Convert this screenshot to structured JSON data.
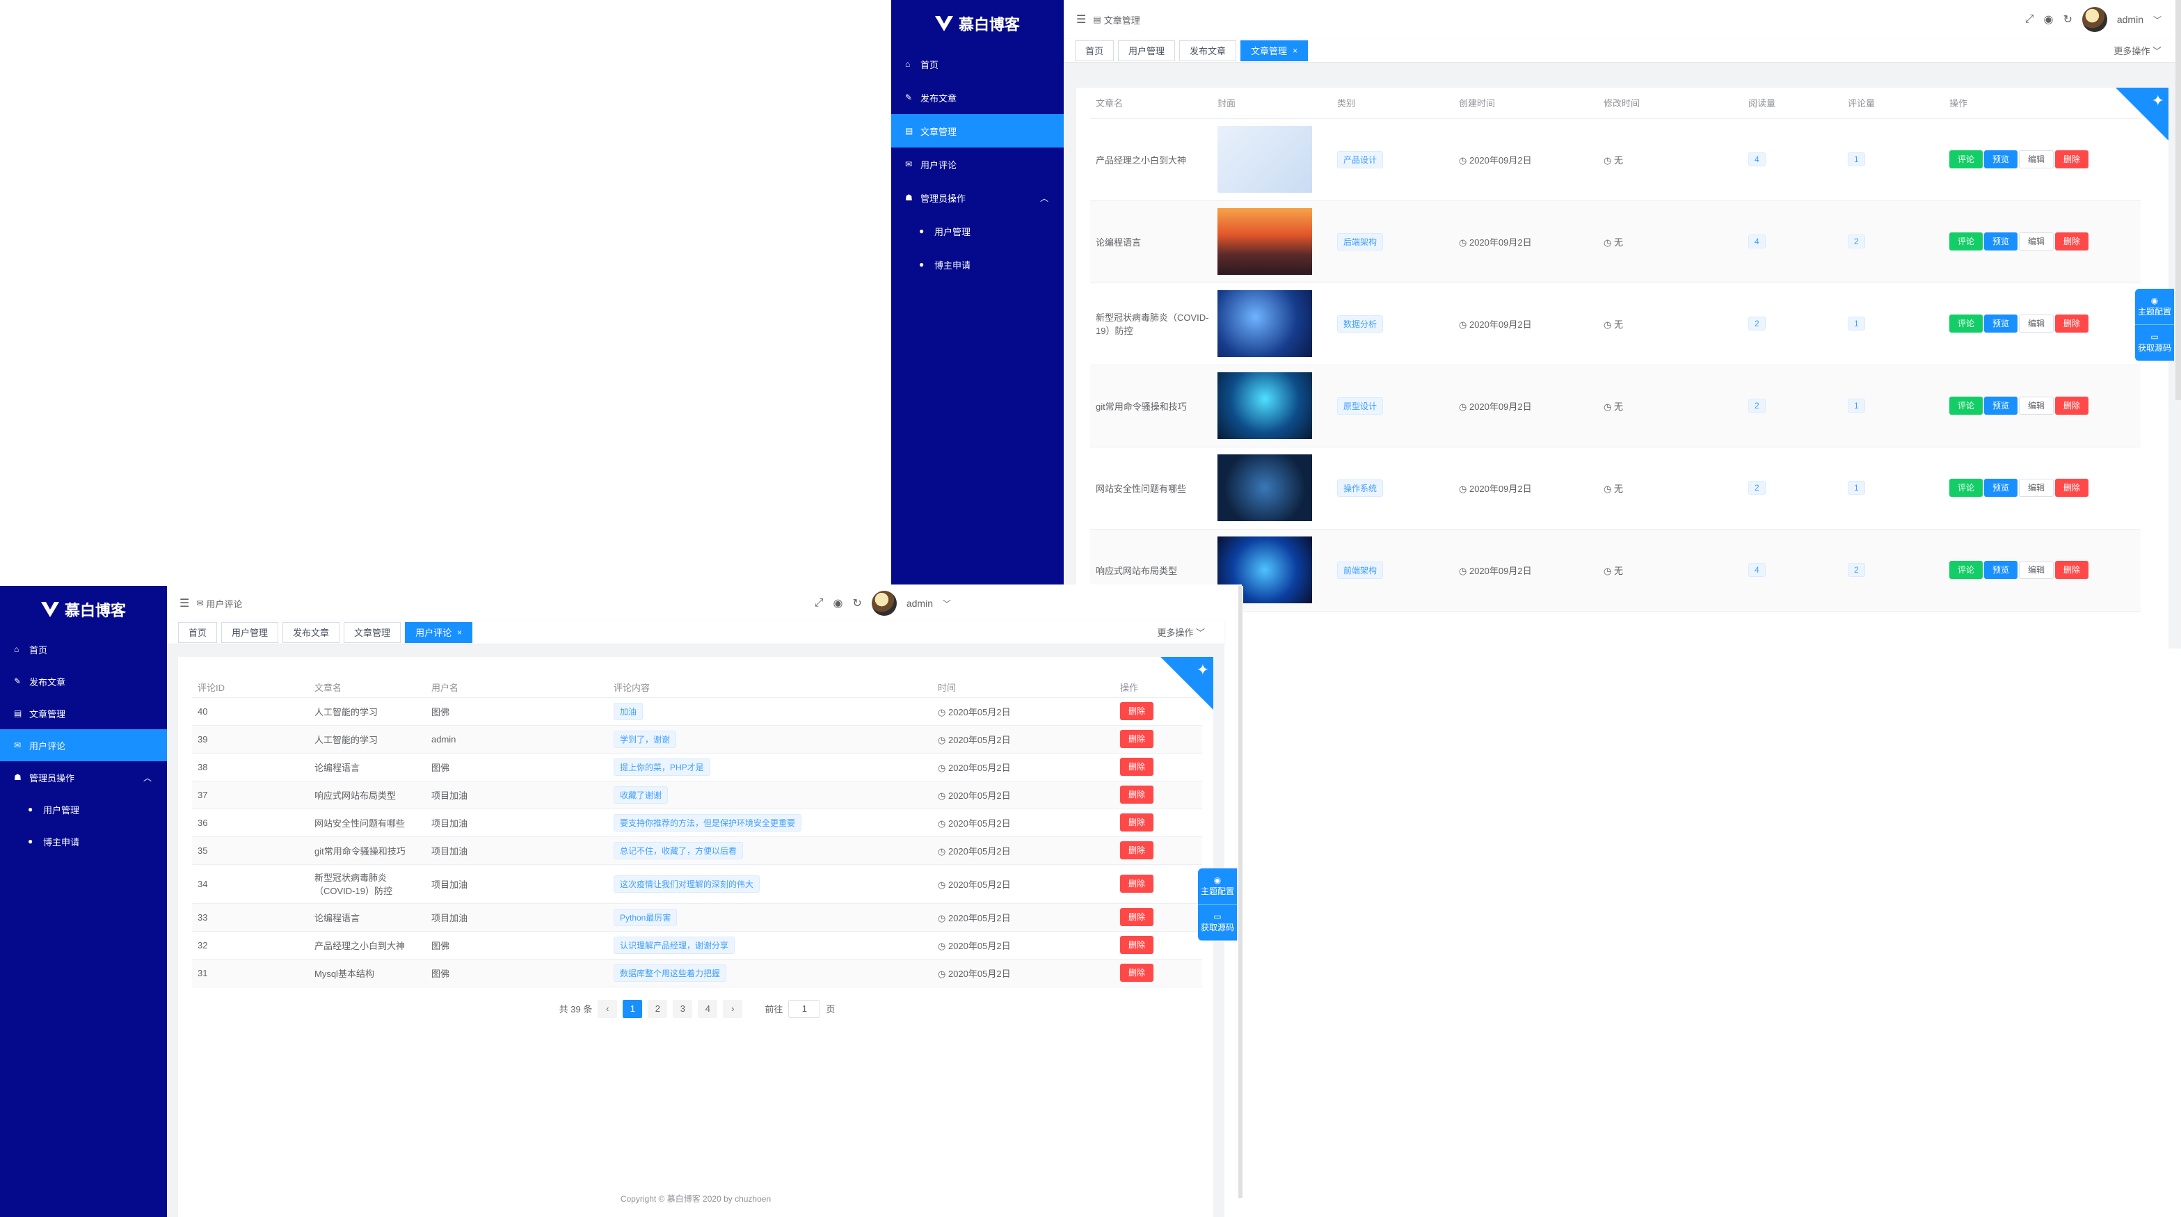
{
  "brand": "慕白博客",
  "sidebar": {
    "items": [
      {
        "label": "首页",
        "icon": "home-icon"
      },
      {
        "label": "发布文章",
        "icon": "edit-icon"
      },
      {
        "label": "文章管理",
        "icon": "book-icon"
      },
      {
        "label": "用户评论",
        "icon": "comment-icon"
      },
      {
        "label": "管理员操作",
        "icon": "users-icon"
      },
      {
        "label": "用户管理",
        "icon": "user-icon"
      },
      {
        "label": "博主申请",
        "icon": "user-icon"
      }
    ]
  },
  "header": {
    "admin": "admin",
    "more_ops": "更多操作"
  },
  "top_window": {
    "breadcrumb": "文章管理",
    "tabs": [
      "首页",
      "用户管理",
      "发布文章",
      "文章管理"
    ],
    "columns": [
      "文章名",
      "封面",
      "类别",
      "创建时间",
      "修改时间",
      "阅读量",
      "评论量",
      "操作"
    ],
    "rows": [
      {
        "title": "产品经理之小白到大神",
        "category": "产品设计",
        "created": "2020年09月2日",
        "modified": "无",
        "reads": "4",
        "comments": "1"
      },
      {
        "title": "论编程语言",
        "category": "后端架构",
        "created": "2020年09月2日",
        "modified": "无",
        "reads": "4",
        "comments": "2"
      },
      {
        "title": "新型冠状病毒肺炎（COVID-19）防控",
        "category": "数据分析",
        "created": "2020年09月2日",
        "modified": "无",
        "reads": "2",
        "comments": "1"
      },
      {
        "title": "git常用命令骚操和技巧",
        "category": "原型设计",
        "created": "2020年09月2日",
        "modified": "无",
        "reads": "2",
        "comments": "1"
      },
      {
        "title": "网站安全性问题有哪些",
        "category": "操作系统",
        "created": "2020年09月2日",
        "modified": "无",
        "reads": "2",
        "comments": "1"
      },
      {
        "title": "响应式网站布局类型",
        "category": "前端架构",
        "created": "2020年09月2日",
        "modified": "无",
        "reads": "4",
        "comments": "2"
      }
    ],
    "actions": {
      "comment": "评论",
      "preview": "预览",
      "edit": "编辑",
      "delete": "删除"
    }
  },
  "side_tools": {
    "theme": "主题配置",
    "source": "获取源码"
  },
  "bottom_window": {
    "breadcrumb": "用户评论",
    "tabs": [
      "首页",
      "用户管理",
      "发布文章",
      "文章管理",
      "用户评论"
    ],
    "columns": [
      "评论ID",
      "文章名",
      "用户名",
      "评论内容",
      "时间",
      "操作"
    ],
    "rows": [
      {
        "id": "40",
        "article": "人工智能的学习",
        "user": "图佛",
        "content": "加油",
        "time": "2020年05月2日"
      },
      {
        "id": "39",
        "article": "人工智能的学习",
        "user": "admin",
        "content": "学到了，谢谢",
        "time": "2020年05月2日"
      },
      {
        "id": "38",
        "article": "论编程语言",
        "user": "图佛",
        "content": "提上你的菜，PHP才是",
        "time": "2020年05月2日"
      },
      {
        "id": "37",
        "article": "响应式网站布局类型",
        "user": "项目加油",
        "content": "收藏了谢谢",
        "time": "2020年05月2日"
      },
      {
        "id": "36",
        "article": "网站安全性问题有哪些",
        "user": "项目加油",
        "content": "要支持你推荐的方法，但是保护环境安全更重要",
        "time": "2020年05月2日"
      },
      {
        "id": "35",
        "article": "git常用命令骚操和技巧",
        "user": "项目加油",
        "content": "总记不住，收藏了，方便以后看",
        "time": "2020年05月2日"
      },
      {
        "id": "34",
        "article": "新型冠状病毒肺炎（COVID-19）防控",
        "user": "项目加油",
        "content": "这次疫情让我们对理解的深刻的伟大",
        "time": "2020年05月2日"
      },
      {
        "id": "33",
        "article": "论编程语言",
        "user": "项目加油",
        "content": "Python最厉害",
        "time": "2020年05月2日"
      },
      {
        "id": "32",
        "article": "产品经理之小白到大神",
        "user": "图佛",
        "content": "认识理解产品经理，谢谢分享",
        "time": "2020年05月2日"
      },
      {
        "id": "31",
        "article": "Mysql基本结构",
        "user": "图佛",
        "content": "数据库整个用这些着力把握",
        "time": "2020年05月2日"
      }
    ],
    "delete": "删除",
    "pagination": {
      "total": "共 39 条",
      "pages": [
        "1",
        "2",
        "3",
        "4"
      ],
      "goto": "前往",
      "goto_value": "1",
      "page_unit": "页"
    },
    "footer": "Copyright © 慕白博客 2020 by chuzhoen"
  },
  "colors": {
    "sidebar": "#050a8c",
    "accent": "#1890ff",
    "success": "#13ce66",
    "danger": "#ff4949"
  }
}
